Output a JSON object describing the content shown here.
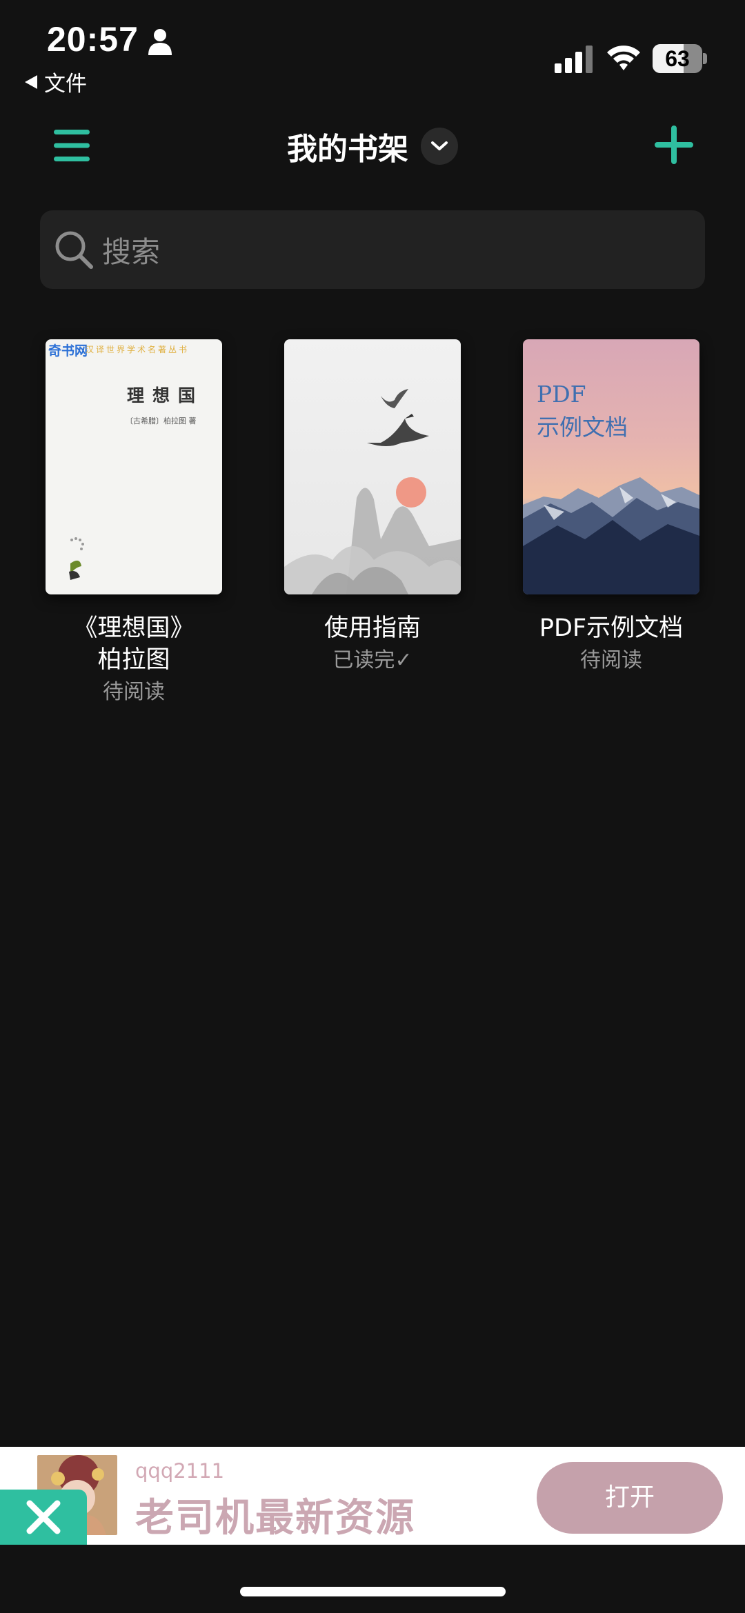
{
  "status_bar": {
    "time": "20:57",
    "back_label": "文件",
    "battery_level": "63",
    "battery_fraction": 0.63,
    "icons": [
      "person-icon",
      "signal-icon",
      "wifi-icon",
      "battery-icon"
    ]
  },
  "header": {
    "title": "我的书架",
    "menu_icon": "menu-icon",
    "add_icon": "plus-icon",
    "dropdown_icon": "chevron-down-icon"
  },
  "search": {
    "placeholder": "搜索",
    "icon": "search-icon"
  },
  "books": [
    {
      "title_line1": "《理想国》",
      "title_line2": "柏拉图",
      "status": "待阅读",
      "cover": {
        "site": "奇书网",
        "series": "汉译世界学术名著丛书",
        "title": "理想国",
        "author": "〔古希腊〕柏拉图 著"
      }
    },
    {
      "title_line1": "使用指南",
      "title_line2": "",
      "status": "已读完✓"
    },
    {
      "title_line1": "PDF示例文档",
      "title_line2": "",
      "status": "待阅读",
      "cover": {
        "line1": "PDF",
        "line2": "示例文档"
      }
    }
  ],
  "ad": {
    "user": "qqq2111",
    "title": "老司机最新资源",
    "open_label": "打开",
    "close_icon": "close-icon"
  },
  "colors": {
    "background": "#121212",
    "accent": "#2fbfa0",
    "search_bg": "#222222",
    "muted_text": "#9a9a9a"
  }
}
